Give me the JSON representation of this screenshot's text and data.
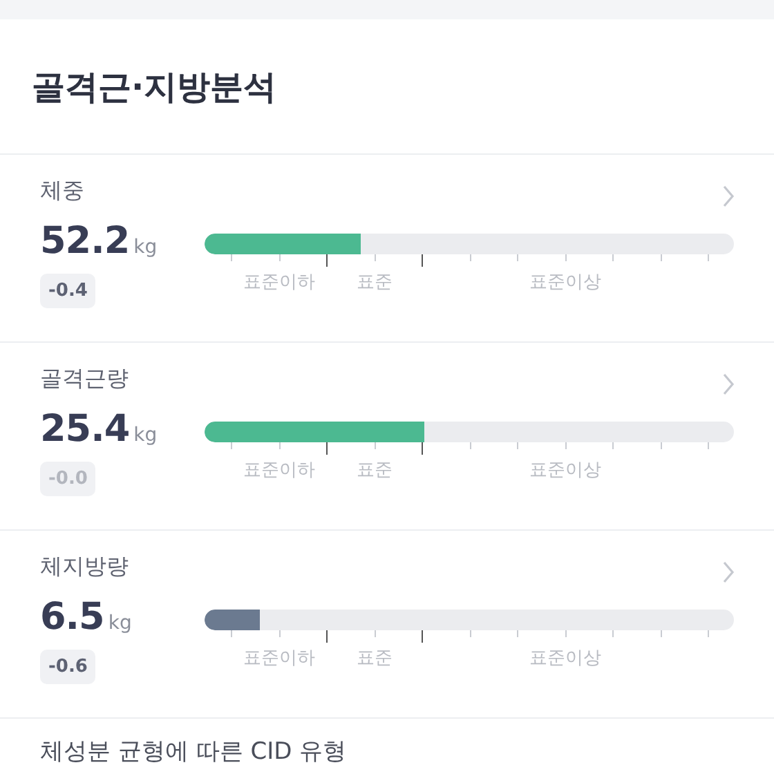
{
  "title": "골격근·지방분석",
  "metrics": [
    {
      "name": "체중",
      "value": "52.2",
      "unit": "kg",
      "change": "-0.4",
      "change_faded": false,
      "level": 0.295,
      "color": "#4cb991",
      "scale_labels": [
        "표준이하",
        "표준",
        "표준이상"
      ]
    },
    {
      "name": "골격근량",
      "value": "25.4",
      "unit": "kg",
      "change": "-0.0",
      "change_faded": true,
      "level": 0.415,
      "color": "#4cb991",
      "scale_labels": [
        "표준이하",
        "표준",
        "표준이상"
      ]
    },
    {
      "name": "체지방량",
      "value": "6.5",
      "unit": "kg",
      "change": "-0.6",
      "change_faded": false,
      "level": 0.104,
      "color": "#6b7a90",
      "scale_labels": [
        "표준이하",
        "표준",
        "표준이상"
      ]
    }
  ],
  "footer_heading": "체성분 균형에 따른 CID 유형"
}
